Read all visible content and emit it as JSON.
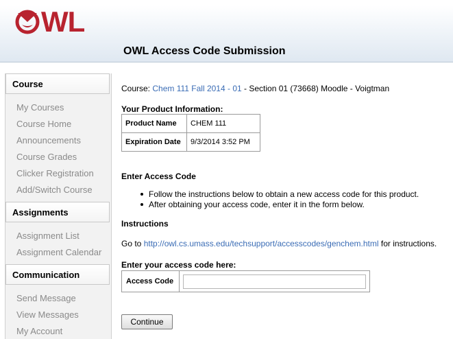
{
  "header": {
    "logo_text": "WL",
    "title": "OWL Access Code Submission"
  },
  "sidebar": {
    "sections": [
      {
        "title": "Course",
        "items": [
          "My Courses",
          "Course Home",
          "Announcements",
          "Course Grades",
          "Clicker Registration",
          "Add/Switch Course"
        ]
      },
      {
        "title": "Assignments",
        "items": [
          "Assignment List",
          "Assignment Calendar"
        ]
      },
      {
        "title": "Communication",
        "items": [
          "Send Message",
          "View Messages",
          "My Account"
        ]
      }
    ]
  },
  "main": {
    "course_label": "Course:",
    "course_link": "Chem 111 Fall 2014 - 01",
    "course_rest": " - Section 01 (73668) Moodle - Voigtman",
    "product_heading": "Your Product Information:",
    "product_rows": [
      {
        "key": "Product Name",
        "value": "CHEM 111"
      },
      {
        "key": "Expiration Date",
        "value": "9/3/2014 3:52 PM"
      }
    ],
    "enter_heading": "Enter Access Code",
    "bullets": [
      "Follow the instructions below to obtain a new access code for this product.",
      "After obtaining your access code, enter it in the form below."
    ],
    "instructions_heading": "Instructions",
    "instructions_prefix": "Go to ",
    "instructions_link": "http://owl.cs.umass.edu/techsupport/accesscodes/genchem.html",
    "instructions_suffix": " for instructions.",
    "code_heading": "Enter your access code here:",
    "code_label": "Access Code",
    "code_value": "",
    "continue_label": "Continue"
  },
  "colors": {
    "brand": "#b8232f",
    "link": "#3a6cb5",
    "sidebar_text": "#8a8a8a"
  }
}
